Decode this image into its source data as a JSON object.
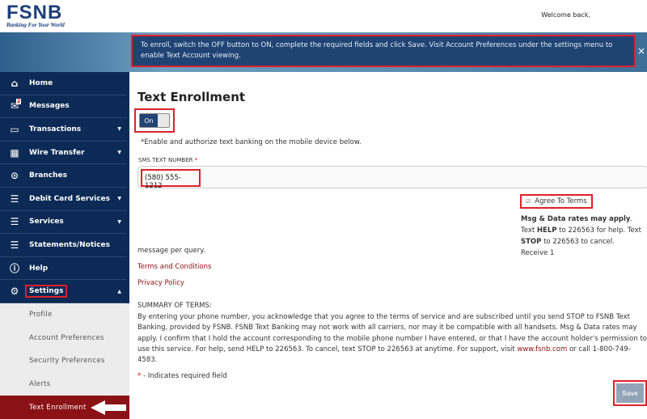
{
  "header": {
    "logo_text": "FSNB",
    "logo_tagline": "Banking For Your World",
    "welcome": "Welcome back,"
  },
  "banner": {
    "message": "To enroll, switch the OFF button to ON, complete the required fields and click Save. Visit Account Preferences under the settings menu to enable Text Account viewing.",
    "close": "×"
  },
  "sidebar": {
    "items": [
      {
        "label": "Home",
        "icon": "home-icon"
      },
      {
        "label": "Messages",
        "icon": "mail-icon",
        "badge": "2"
      },
      {
        "label": "Transactions",
        "icon": "card-icon",
        "caret": "▼"
      },
      {
        "label": "Wire Transfer",
        "icon": "building-icon",
        "caret": "▼"
      },
      {
        "label": "Branches",
        "icon": "location-pin-icon"
      },
      {
        "label": "Debit Card Services",
        "icon": "menu-icon",
        "caret": "▼"
      },
      {
        "label": "Services",
        "icon": "menu-icon",
        "caret": "▼"
      },
      {
        "label": "Statements/Notices",
        "icon": "menu-icon"
      },
      {
        "label": "Help",
        "icon": "help-icon"
      },
      {
        "label": "Settings",
        "icon": "gear-icon",
        "caret": "▲"
      }
    ],
    "submenu": [
      "Profile",
      "Account Preferences",
      "Security Preferences",
      "Alerts",
      "Text Enrollment"
    ]
  },
  "main": {
    "title": "Text Enrollment",
    "toggle_label": "On",
    "toggle_state": "on",
    "hint": "*Enable and authorize text banking on the mobile device below.",
    "sms_label": "SMS Text Number",
    "required_star": "*",
    "phone_value": "(580) 555-1212",
    "agree_label": "Agree To Terms",
    "agree_checked": true,
    "rates_bold": "Msg & Data rates may apply",
    "rates_1": ". Text ",
    "help_bold": "HELP",
    "rates_2": " to 226563 for help. Text ",
    "stop_bold": "STOP",
    "rates_3": " to 226563 to cancel. Receive 1",
    "rates_cont": "message per query.",
    "terms_link": "Terms and Conditions",
    "privacy_link": "Privacy Policy",
    "summary_heading": "SUMMARY OF TERMS:",
    "summary_text": "By entering your phone number, you acknowledge that you agree to the terms of service and are subscribed until you send STOP to FSNB Text Banking, provided by FSNB. FSNB Text Banking may not work with all carriers, nor may it be compatible with all handsets. Msg & Data rates may apply. I confirm that I hold the account corresponding to the mobile phone number I have entered, or that I have the account holder's permission to use this service. For help, send HELP to 226563. To cancel, text STOP to 226563 at anytime. For support, visit ",
    "summary_link": "www.fsnb.com",
    "summary_end": " or call 1-800-749-4583.",
    "required_note": " - Indicates required field",
    "save_label": "Save"
  },
  "colors": {
    "navy": "#0c2a55",
    "active": "#8a1116",
    "highlight": "#e0202a"
  }
}
